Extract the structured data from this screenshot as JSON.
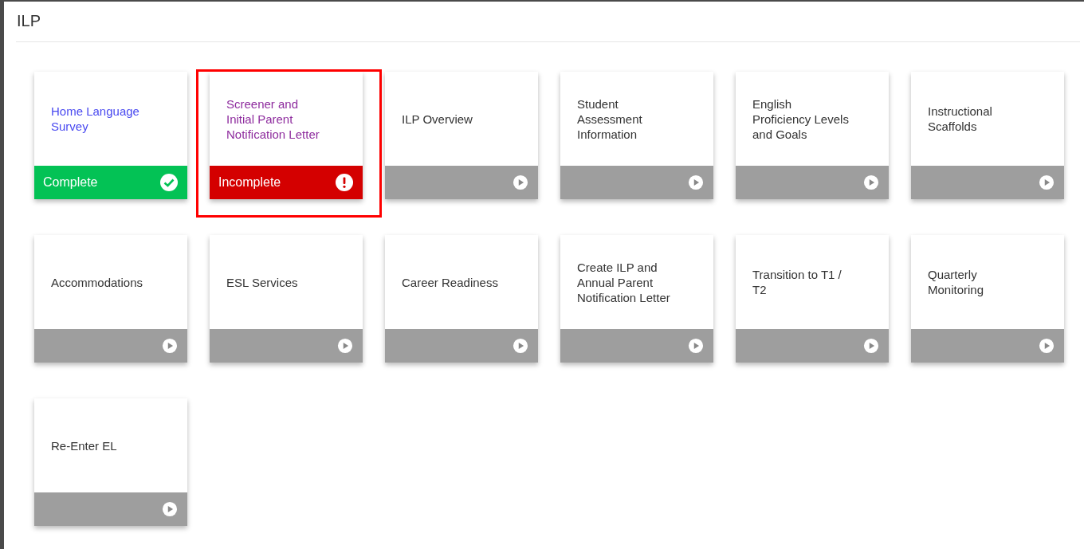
{
  "page": {
    "title": "ILP"
  },
  "cards": [
    {
      "title": "Home Language Survey",
      "color": "#4a4af0",
      "kind": "complete",
      "status_label": "Complete",
      "selected": false
    },
    {
      "title": "Screener and Initial Parent Notification Letter",
      "color": "#8e2c9e",
      "kind": "incomplete",
      "status_label": "Incomplete",
      "selected": true
    },
    {
      "title": "ILP Overview",
      "kind": "none",
      "selected": false
    },
    {
      "title": "Student Assessment Information",
      "kind": "none",
      "selected": false
    },
    {
      "title": "English Proficiency Levels and Goals",
      "kind": "none",
      "selected": false
    },
    {
      "title": "Instructional Scaffolds",
      "kind": "none",
      "selected": false
    },
    {
      "title": "Accommodations",
      "kind": "none",
      "selected": false
    },
    {
      "title": "ESL Services",
      "kind": "none",
      "selected": false
    },
    {
      "title": "Career Readiness",
      "kind": "none",
      "selected": false
    },
    {
      "title": "Create ILP and Annual Parent Notification Letter",
      "kind": "none",
      "selected": false
    },
    {
      "title": "Transition to T1 / T2",
      "kind": "none",
      "selected": false
    },
    {
      "title": "Quarterly Monitoring",
      "kind": "none",
      "selected": false
    },
    {
      "title": "Re-Enter EL",
      "kind": "none",
      "selected": false
    }
  ]
}
